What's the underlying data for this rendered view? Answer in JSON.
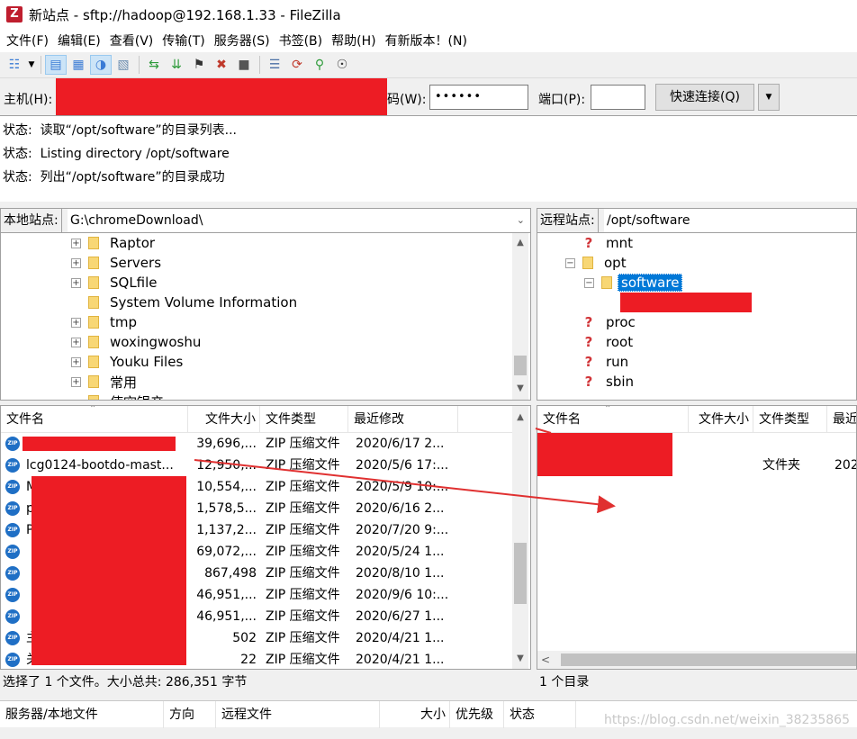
{
  "window": {
    "title": "新站点 - sftp://hadoop@192.168.1.33 - FileZilla",
    "app_icon": "filezilla-icon"
  },
  "menu": [
    "文件(F)",
    "编辑(E)",
    "查看(V)",
    "传输(T)",
    "服务器(S)",
    "书签(B)",
    "帮助(H)",
    "有新版本！(N)"
  ],
  "quickconnect": {
    "host_label": "主机(H):",
    "password_label": "码(W):",
    "password_value": "••••••",
    "port_label": "端口(P):",
    "port_value": "",
    "connect_button": "快速连接(Q)"
  },
  "log": [
    {
      "label": "状态:",
      "text": "读取“/opt/software”的目录列表..."
    },
    {
      "label": "状态:",
      "text": "Listing directory /opt/software"
    },
    {
      "label": "状态:",
      "text": "列出“/opt/software”的目录成功"
    }
  ],
  "local": {
    "site_label": "本地站点:",
    "path": "G:\\chromeDownload\\",
    "tree": [
      "Raptor",
      "Servers",
      "SQLfile",
      "System Volume Information",
      "tmp",
      "woxingwoshu",
      "Youku Files",
      "常用",
      "使空银产"
    ],
    "columns": [
      "文件名",
      "文件大小",
      "文件类型",
      "最近修改"
    ],
    "files": [
      {
        "name": "",
        "size": "39,696,...",
        "type": "ZIP 压缩文件",
        "modified": "2020/6/17 2..."
      },
      {
        "name": "lcg0124-bootdo-mast...",
        "size": "12,950,...",
        "type": "ZIP 压缩文件",
        "modified": "2020/5/6 17:..."
      },
      {
        "name": "M",
        "size": "10,554,...",
        "type": "ZIP 压缩文件",
        "modified": "2020/5/9 10:..."
      },
      {
        "name": "p",
        "size": "1,578,5...",
        "type": "ZIP 压缩文件",
        "modified": "2020/6/16 2..."
      },
      {
        "name": "P",
        "size": "1,137,2...",
        "type": "ZIP 压缩文件",
        "modified": "2020/7/20 9:..."
      },
      {
        "name": "",
        "size": "69,072,...",
        "type": "ZIP 压缩文件",
        "modified": "2020/5/24 1..."
      },
      {
        "name": "",
        "size": "867,498",
        "type": "ZIP 压缩文件",
        "modified": "2020/8/10 1..."
      },
      {
        "name": "",
        "size": "46,951,...",
        "type": "ZIP 压缩文件",
        "modified": "2020/9/6 10:..."
      },
      {
        "name": "",
        "size": "46,951,...",
        "type": "ZIP 压缩文件",
        "modified": "2020/6/27 1..."
      },
      {
        "name": "主",
        "size": "502",
        "type": "ZIP 压缩文件",
        "modified": "2020/4/21 1..."
      },
      {
        "name": "关",
        "size": "22",
        "type": "ZIP 压缩文件",
        "modified": "2020/4/21 1..."
      }
    ],
    "status": "选择了 1 个文件。大小总共: 286,351 字节"
  },
  "remote": {
    "site_label": "远程站点:",
    "path": "/opt/software",
    "tree": [
      "mnt",
      "opt",
      "software",
      "proc",
      "root",
      "run",
      "sbin"
    ],
    "columns": [
      "文件名",
      "文件大小",
      "文件类型",
      "最近修改"
    ],
    "files": [
      {
        "name": "",
        "size": "",
        "type": "文件夹",
        "modified": "202"
      }
    ],
    "status": "1 个目录"
  },
  "queue": {
    "columns": [
      "服务器/本地文件",
      "方向",
      "远程文件",
      "大小",
      "优先级",
      "状态"
    ]
  },
  "watermark": "https://blog.csdn.net/weixin_38235865",
  "colors": {
    "redaction": "#ed1c24",
    "selection": "#0078d7",
    "zip_icon": "#1f6fc5"
  }
}
